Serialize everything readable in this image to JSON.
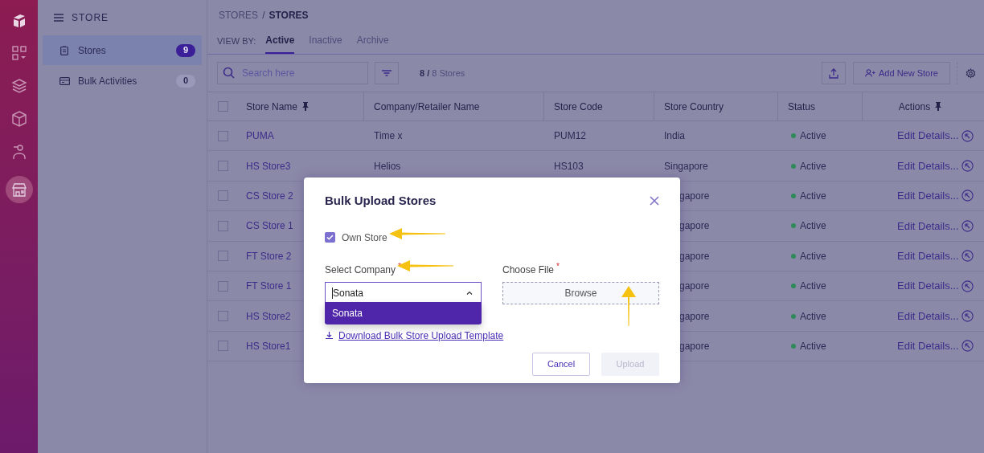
{
  "rail": {
    "items": [
      {
        "selected": false
      },
      {
        "selected": false
      },
      {
        "selected": false
      },
      {
        "selected": false
      },
      {
        "selected": false
      },
      {
        "selected": true
      }
    ]
  },
  "sidebar": {
    "title": "STORE",
    "items": [
      {
        "label": "Stores",
        "count": "9",
        "selected": true
      },
      {
        "label": "Bulk Activities",
        "count": "0",
        "selected": false
      }
    ]
  },
  "breadcrumb": {
    "items": [
      "STORES",
      "STORES"
    ],
    "separator": "/"
  },
  "view_by": {
    "label": "VIEW BY:",
    "tabs": [
      {
        "label": "Active",
        "selected": true
      },
      {
        "label": "Inactive",
        "selected": false
      },
      {
        "label": "Archive",
        "selected": false
      }
    ]
  },
  "toolbar": {
    "search": {
      "placeholder": "Search here"
    },
    "count_shown": "8 /",
    "count_total": "8 Stores",
    "add_button": "Add New Store"
  },
  "table": {
    "header_checked": false,
    "columns": [
      {
        "label": "Store Name",
        "pinned": true
      },
      {
        "label": "Company/Retailer Name",
        "pinned": false
      },
      {
        "label": "Store Code",
        "pinned": false
      },
      {
        "label": "Store Country",
        "pinned": false
      },
      {
        "label": "Status",
        "pinned": false
      },
      {
        "label": "Actions",
        "pinned": true
      }
    ],
    "rows": [
      {
        "checked": false,
        "store_name": "PUMA",
        "company": "Time x",
        "code": "PUM12",
        "country": "India",
        "status": "Active",
        "action": "Edit Details..."
      },
      {
        "checked": false,
        "store_name": "HS Store3",
        "company": "Helios",
        "code": "HS103",
        "country": "Singapore",
        "status": "Active",
        "action": "Edit Details..."
      },
      {
        "checked": false,
        "store_name": "CS Store 2",
        "country": "gapore",
        "status": "Active",
        "action": "Edit Details..."
      },
      {
        "checked": false,
        "store_name": "CS Store 1",
        "country": "gapore",
        "status": "Active",
        "action": "Edit Details..."
      },
      {
        "checked": false,
        "store_name": "FT Store 2",
        "country": "gapore",
        "status": "Active",
        "action": "Edit Details..."
      },
      {
        "checked": false,
        "store_name": "FT Store 1",
        "country": "gapore",
        "status": "Active",
        "action": "Edit Details..."
      },
      {
        "checked": false,
        "store_name": "HS Store2",
        "country": "gapore",
        "status": "Active",
        "action": "Edit Details..."
      },
      {
        "checked": false,
        "store_name": "HS Store1",
        "country": "gapore",
        "status": "Active",
        "action": "Edit Details..."
      }
    ]
  },
  "modal": {
    "title": "Bulk Upload Stores",
    "own_store": {
      "label": "Own Store",
      "checked": true
    },
    "company": {
      "label": "Select Company",
      "required_mark": "*",
      "value": "Sonata",
      "expanded": true,
      "options": [
        {
          "label": "Sonata",
          "selected": true
        }
      ]
    },
    "file": {
      "label": "Choose File",
      "required_mark": "*",
      "button": "Browse"
    },
    "template_link": "Download Bulk Store Upload Template",
    "buttons": [
      {
        "label": "Cancel",
        "disabled": false
      },
      {
        "label": "Upload",
        "disabled": true
      }
    ]
  }
}
